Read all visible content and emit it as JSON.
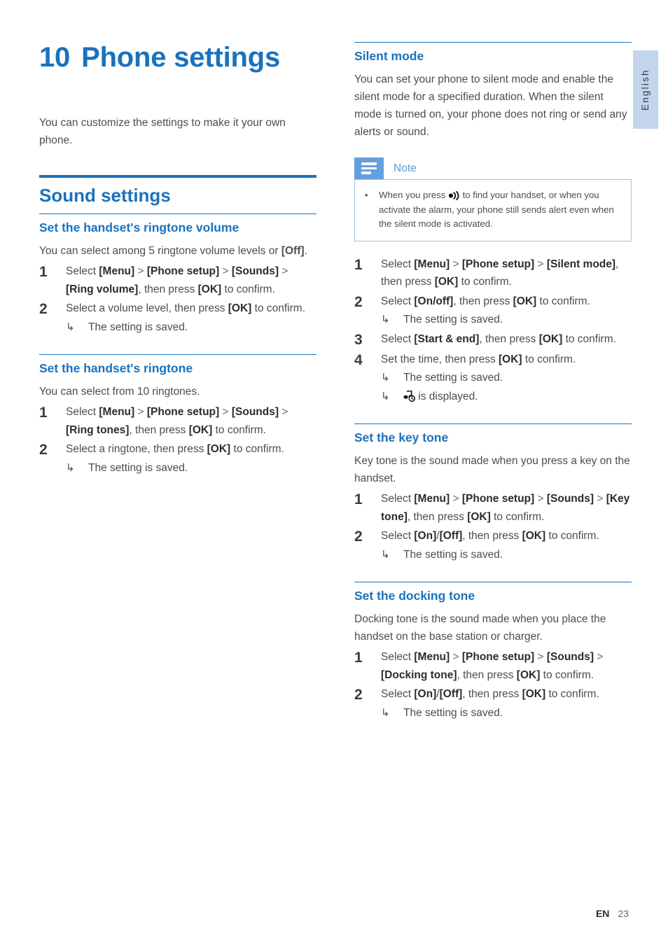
{
  "page": {
    "language_tab": "English",
    "footer": {
      "locale": "EN",
      "page_number": "23"
    }
  },
  "chapter": {
    "number": "10",
    "title": "Phone settings"
  },
  "intro": "You can customize the settings to make it your own phone.",
  "left_column": {
    "section_heading": "Sound settings",
    "subsections": [
      {
        "heading": "Set the handset's ringtone volume",
        "intro_parts": [
          {
            "t": "You can select among 5 ringtone volume levels or ",
            "b": false
          },
          {
            "t": "[Off]",
            "b": true
          },
          {
            "t": ".",
            "b": false
          }
        ],
        "steps": [
          {
            "num": "1",
            "parts": [
              {
                "t": "Select ",
                "b": false
              },
              {
                "t": "[Menu]",
                "b": true
              },
              {
                "t": " > ",
                "gt": true
              },
              {
                "t": "[Phone setup]",
                "b": true
              },
              {
                "t": " > ",
                "gt": true
              },
              {
                "t": "[Sounds]",
                "b": true
              },
              {
                "t": " > ",
                "gt": true
              },
              {
                "t": "[Ring volume]",
                "b": true
              },
              {
                "t": ", then press ",
                "b": false
              },
              {
                "t": "[OK]",
                "b": true
              },
              {
                "t": " to confirm.",
                "b": false
              }
            ],
            "results": []
          },
          {
            "num": "2",
            "parts": [
              {
                "t": "Select a volume level, then press ",
                "b": false
              },
              {
                "t": "[OK]",
                "b": true
              },
              {
                "t": " to confirm.",
                "b": false
              }
            ],
            "results": [
              {
                "text": "The setting is saved."
              }
            ]
          }
        ]
      },
      {
        "heading": "Set the handset's ringtone",
        "intro_parts": [
          {
            "t": "You can select from 10 ringtones.",
            "b": false
          }
        ],
        "steps": [
          {
            "num": "1",
            "parts": [
              {
                "t": "Select ",
                "b": false
              },
              {
                "t": "[Menu]",
                "b": true
              },
              {
                "t": " > ",
                "gt": true
              },
              {
                "t": "[Phone setup]",
                "b": true
              },
              {
                "t": " > ",
                "gt": true
              },
              {
                "t": "[Sounds]",
                "b": true
              },
              {
                "t": " > ",
                "gt": true
              },
              {
                "t": "[Ring tones]",
                "b": true
              },
              {
                "t": ", then press ",
                "b": false
              },
              {
                "t": "[OK]",
                "b": true
              },
              {
                "t": " to confirm.",
                "b": false
              }
            ],
            "results": []
          },
          {
            "num": "2",
            "parts": [
              {
                "t": "Select a ringtone, then press ",
                "b": false
              },
              {
                "t": "[OK]",
                "b": true
              },
              {
                "t": " to confirm.",
                "b": false
              }
            ],
            "results": [
              {
                "text": "The setting is saved."
              }
            ]
          }
        ]
      }
    ]
  },
  "right_column": {
    "subsections": [
      {
        "heading": "Silent mode",
        "intro_parts": [
          {
            "t": "You can set your phone to silent mode and enable the silent mode for a specified duration. When the silent mode is turned on, your phone does not ring or send any alerts or sound.",
            "b": false
          }
        ],
        "note": {
          "title": "Note",
          "bullet_pre": "When you press ",
          "bullet_icon": "paging-icon",
          "bullet_post": " to find your handset, or when you activate the alarm, your phone still sends alert even when the silent mode is activated."
        },
        "steps": [
          {
            "num": "1",
            "parts": [
              {
                "t": "Select ",
                "b": false
              },
              {
                "t": "[Menu]",
                "b": true
              },
              {
                "t": " > ",
                "gt": true
              },
              {
                "t": "[Phone setup]",
                "b": true
              },
              {
                "t": " > ",
                "gt": true
              },
              {
                "t": "[Silent mode]",
                "b": true
              },
              {
                "t": ", then press ",
                "b": false
              },
              {
                "t": "[OK]",
                "b": true
              },
              {
                "t": " to confirm.",
                "b": false
              }
            ],
            "results": []
          },
          {
            "num": "2",
            "parts": [
              {
                "t": "Select ",
                "b": false
              },
              {
                "t": "[On/off]",
                "b": true
              },
              {
                "t": ", then press ",
                "b": false
              },
              {
                "t": "[OK]",
                "b": true
              },
              {
                "t": " to confirm.",
                "b": false
              }
            ],
            "results": [
              {
                "text": "The setting is saved."
              }
            ]
          },
          {
            "num": "3",
            "parts": [
              {
                "t": "Select ",
                "b": false
              },
              {
                "t": "[Start & end]",
                "b": true
              },
              {
                "t": ", then press ",
                "b": false
              },
              {
                "t": "[OK]",
                "b": true
              },
              {
                "t": " to confirm.",
                "b": false
              }
            ],
            "results": []
          },
          {
            "num": "4",
            "parts": [
              {
                "t": "Set the time, then press ",
                "b": false
              },
              {
                "t": "[OK]",
                "b": true
              },
              {
                "t": " to confirm.",
                "b": false
              }
            ],
            "results": [
              {
                "text": "The setting is saved."
              },
              {
                "icon": "silent-timer-icon",
                "text": "is displayed."
              }
            ]
          }
        ]
      },
      {
        "heading": "Set the key tone",
        "intro_parts": [
          {
            "t": "Key tone is the sound made when you press a key on the handset.",
            "b": false
          }
        ],
        "steps": [
          {
            "num": "1",
            "parts": [
              {
                "t": "Select ",
                "b": false
              },
              {
                "t": "[Menu]",
                "b": true
              },
              {
                "t": " > ",
                "gt": true
              },
              {
                "t": "[Phone setup]",
                "b": true
              },
              {
                "t": " > ",
                "gt": true
              },
              {
                "t": "[Sounds]",
                "b": true
              },
              {
                "t": " > ",
                "gt": true
              },
              {
                "t": "[Key tone]",
                "b": true
              },
              {
                "t": ", then press ",
                "b": false
              },
              {
                "t": "[OK]",
                "b": true
              },
              {
                "t": " to confirm.",
                "b": false
              }
            ],
            "results": []
          },
          {
            "num": "2",
            "parts": [
              {
                "t": "Select ",
                "b": false
              },
              {
                "t": "[On]",
                "b": true
              },
              {
                "t": "/",
                "b": false
              },
              {
                "t": "[Off]",
                "b": true
              },
              {
                "t": ", then press ",
                "b": false
              },
              {
                "t": "[OK]",
                "b": true
              },
              {
                "t": " to confirm.",
                "b": false
              }
            ],
            "results": [
              {
                "text": "The setting is saved."
              }
            ]
          }
        ]
      },
      {
        "heading": "Set the docking tone",
        "intro_parts": [
          {
            "t": "Docking tone is the sound made when you place the handset on the base station or charger.",
            "b": false
          }
        ],
        "steps": [
          {
            "num": "1",
            "parts": [
              {
                "t": "Select ",
                "b": false
              },
              {
                "t": "[Menu]",
                "b": true
              },
              {
                "t": " > ",
                "gt": true
              },
              {
                "t": "[Phone setup]",
                "b": true
              },
              {
                "t": " > ",
                "gt": true
              },
              {
                "t": "[Sounds]",
                "b": true
              },
              {
                "t": " > ",
                "gt": true
              },
              {
                "t": "[Docking tone]",
                "b": true
              },
              {
                "t": ", then press ",
                "b": false
              },
              {
                "t": "[OK]",
                "b": true
              },
              {
                "t": " to confirm.",
                "b": false
              }
            ],
            "results": []
          },
          {
            "num": "2",
            "parts": [
              {
                "t": "Select ",
                "b": false
              },
              {
                "t": "[On]",
                "b": true
              },
              {
                "t": "/",
                "b": false
              },
              {
                "t": "[Off]",
                "b": true
              },
              {
                "t": ", then press ",
                "b": false
              },
              {
                "t": "[OK]",
                "b": true
              },
              {
                "t": " to confirm.",
                "b": false
              }
            ],
            "results": [
              {
                "text": "The setting is saved."
              }
            ]
          }
        ]
      }
    ]
  },
  "colors": {
    "accent_blue": "#1a72bd",
    "note_icon_blue": "#63a0dd",
    "note_border_blue": "#9fc0e4",
    "lang_tab_blue": "#c2d5ed",
    "body_text": "#4d4d4d"
  },
  "icons": {
    "arrow_result": "↳",
    "bullet": "•",
    "gt_separator": ">"
  }
}
